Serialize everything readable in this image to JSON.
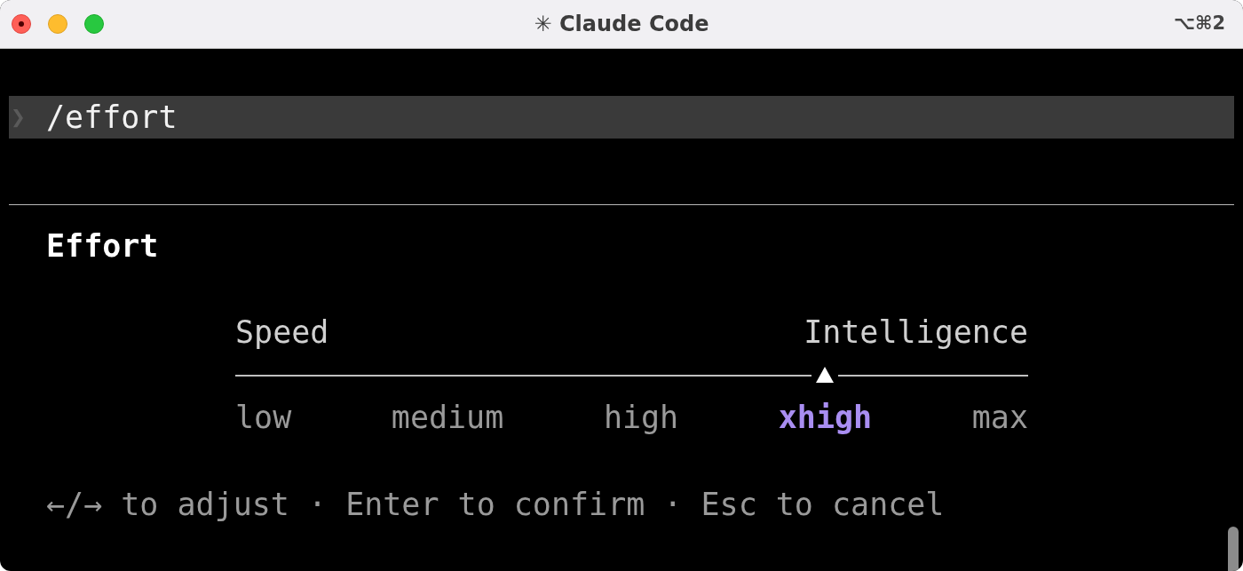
{
  "window": {
    "title": "✳ Claude Code",
    "shortcut": "⌥⌘2"
  },
  "prompt": {
    "symbol": "❯",
    "command": "/effort"
  },
  "effort": {
    "title": "Effort",
    "left_label": "Speed",
    "right_label": "Intelligence",
    "options": [
      {
        "label": "low",
        "selected": false
      },
      {
        "label": "medium",
        "selected": false
      },
      {
        "label": "high",
        "selected": false
      },
      {
        "label": "xhigh",
        "selected": true
      },
      {
        "label": "max",
        "selected": false
      }
    ]
  },
  "hint": "←/→ to adjust · Enter to confirm · Esc to cancel"
}
